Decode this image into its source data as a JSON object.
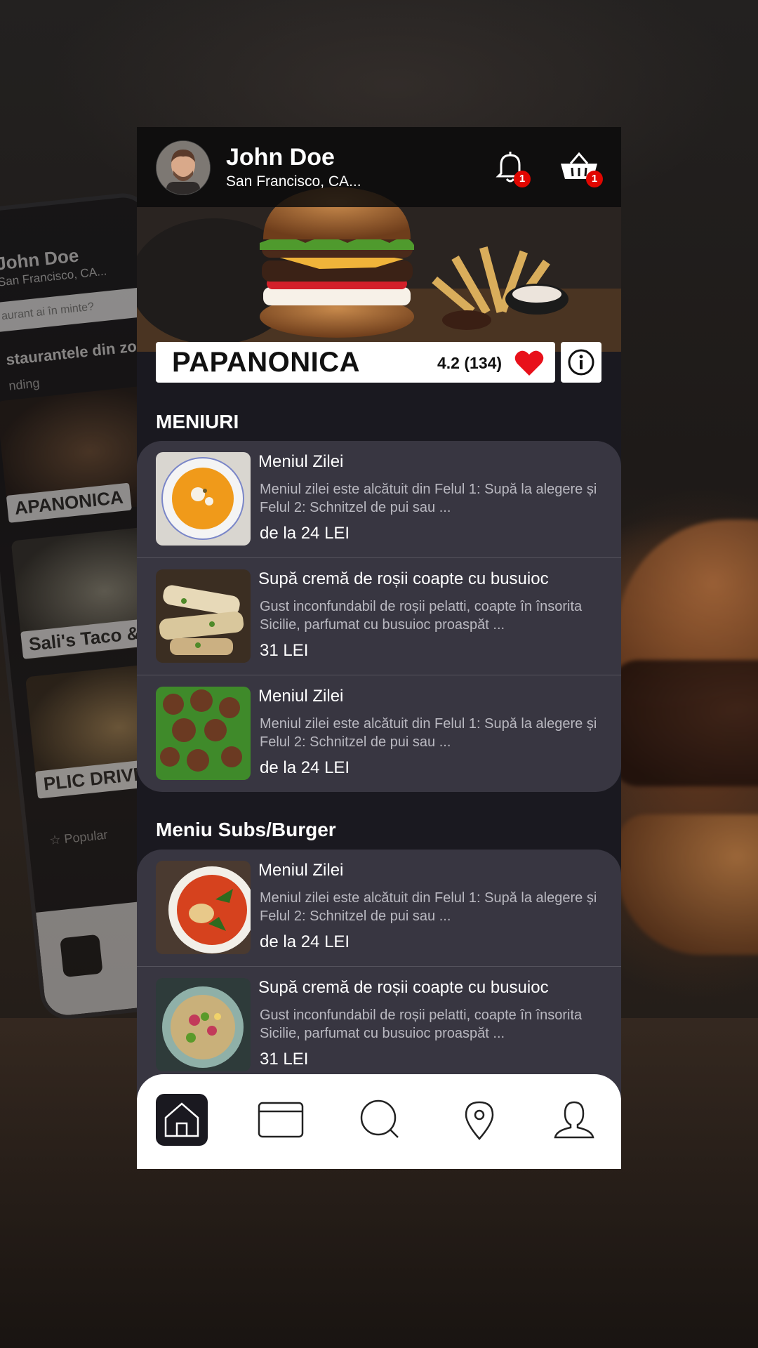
{
  "ghost": {
    "name": "John Doe",
    "location": "San Francisco, CA...",
    "search": "aurant ai în minte?",
    "title": "staurantele din zon",
    "trend": "nding",
    "cards": [
      "APANONICA",
      "Sali's Taco & Tur",
      "PLIC DRIVE"
    ],
    "popular": "Popular"
  },
  "header": {
    "user_name": "John Doe",
    "location": "San Francisco, CA...",
    "notifications_badge": "1",
    "cart_badge": "1"
  },
  "restaurant": {
    "name": "PAPANONICA",
    "rating": "4.2 (134)"
  },
  "sections": [
    {
      "title": "MENIURI",
      "items": [
        {
          "title": "Meniul Zilei",
          "desc": "Meniul zilei este alcătuit din Felul 1: Supă la alegere și Felul 2: Schnitzel de pui sau ...",
          "price": "de la 24 LEI",
          "image": "soup-bowl"
        },
        {
          "title": "Supă cremă de roșii coapte cu busuioc",
          "desc": "Gust inconfundabil de roșii pelatti, coapte în însorita Sicilie, parfumat cu busuioc proaspăt ...",
          "price": "31 LEI",
          "image": "grilled-rolls"
        },
        {
          "title": "Meniul Zilei",
          "desc": "Meniul zilei este alcătuit din Felul 1: Supă la alegere și Felul 2: Schnitzel de pui sau ...",
          "price": "de la 24 LEI",
          "image": "meatballs"
        }
      ]
    },
    {
      "title": "Meniu Subs/Burger",
      "items": [
        {
          "title": "Meniul Zilei",
          "desc": "Meniul zilei este alcătuit din Felul 1: Supă la alegere și Felul 2: Schnitzel de pui sau ...",
          "price": "de la 24 LEI",
          "image": "curry-bowl"
        },
        {
          "title": "Supă cremă de roșii coapte cu busuioc",
          "desc": "Gust inconfundabil de roșii pelatti, coapte în însorita Sicilie, parfumat cu busuioc proaspăt ...",
          "price": "31 LEI",
          "image": "salad-bowl"
        }
      ]
    }
  ],
  "nav": {
    "items": [
      "home-icon",
      "card-icon",
      "search-icon",
      "location-pin-icon",
      "profile-icon"
    ],
    "active": "home-icon"
  },
  "colors": {
    "background": "#1a1920",
    "card": "#383641",
    "badge": "#e10600",
    "heart": "#e8101a"
  }
}
